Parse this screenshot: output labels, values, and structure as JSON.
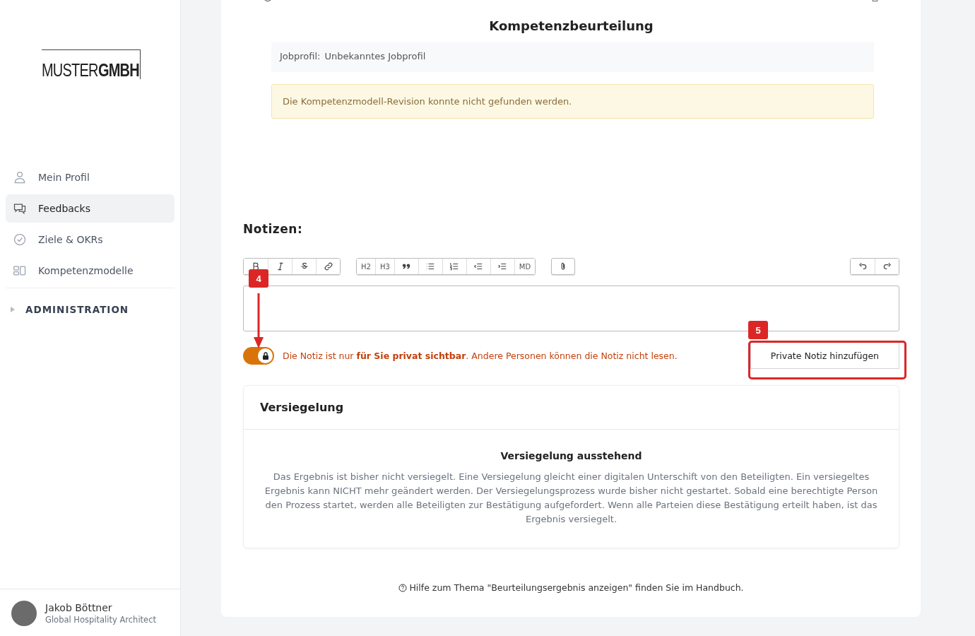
{
  "sidebar": {
    "logo": {
      "light": "MUSTER",
      "bold": "GMBH"
    },
    "items": [
      {
        "label": "Mein Profil",
        "selected": false
      },
      {
        "label": "Feedbacks",
        "selected": true
      },
      {
        "label": "Ziele & OKRs",
        "selected": false
      },
      {
        "label": "Kompetenzmodelle",
        "selected": false
      }
    ],
    "section": {
      "label": "ADMINISTRATION",
      "expanded": false
    },
    "user": {
      "name": "Jakob Böttner",
      "role": "Global Hospitality Architect"
    }
  },
  "assessment": {
    "title": "Kompetenzbeurteilung",
    "jobprofile_label": "Jobprofil:",
    "jobprofile_value": "Unbekanntes Jobprofil",
    "warning": "Die Kompetenzmodell-Revision konnte nicht gefunden werden."
  },
  "notes": {
    "heading": "Notizen:",
    "toolbar": [
      [
        {
          "kind": "icon"
        },
        {
          "kind": "icon"
        },
        {
          "kind": "icon"
        },
        {
          "kind": "icon"
        }
      ],
      [
        {
          "kind": "text",
          "label": "H2"
        },
        {
          "kind": "text",
          "label": "H3"
        },
        {
          "kind": "icon"
        },
        {
          "kind": "icon"
        },
        {
          "kind": "icon"
        },
        {
          "kind": "icon"
        },
        {
          "kind": "icon"
        },
        {
          "kind": "text",
          "label": "MD"
        }
      ],
      [
        {
          "kind": "icon"
        }
      ]
    ],
    "history": [
      {
        "kind": "icon"
      },
      {
        "kind": "icon"
      }
    ],
    "private": {
      "on": true,
      "text": "Die Notiz ist nur **für Sie privat sichtbar**. Andere Personen können die Notiz nicht lesen."
    },
    "button": "Private Notiz hinzufügen"
  },
  "annotations": [
    {
      "label": "4"
    },
    {
      "label": "5"
    }
  ],
  "seal": {
    "title": "Versiegelung",
    "status": "Versiegelung ausstehend",
    "text": "Das Ergebnis ist bisher nicht versiegelt. Eine Versiegelung gleicht einer digitalen Unterschift von den Beteiligten. Ein versiegeltes Ergebnis kann NICHT mehr geändert werden. Der Versiegelungsprozess wurde bisher nicht gestartet. Sobald eine berechtigte Person den Prozess startet, werden alle Beteiligten zur Bestätigung aufgefordert. Wenn alle Parteien diese Bestätigung erteilt haben, ist das Ergebnis versiegelt."
  },
  "help": "Hilfe zum Thema \"Beurteilungsergebnis anzeigen\" finden Sie im Handbuch."
}
